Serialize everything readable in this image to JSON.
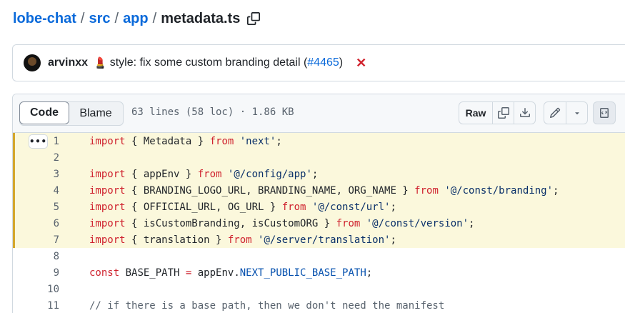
{
  "breadcrumb": {
    "repo": "lobe-chat",
    "dir1": "src",
    "dir2": "app",
    "sep": "/",
    "file": "metadata.ts"
  },
  "commit": {
    "author": "arvinxx",
    "emoji": "💄",
    "message_prefix": "style: fix some custom branding detail (",
    "pr": "#4465",
    "message_suffix": ")",
    "status_icon": "x-icon",
    "status_color": "#d1242f"
  },
  "toolbar": {
    "code_tab": "Code",
    "blame_tab": "Blame",
    "file_info": "63 lines (58 loc) · 1.86 KB",
    "raw_label": "Raw",
    "icons": [
      "copy-icon",
      "download-icon",
      "pencil-icon",
      "chevron-down-icon",
      "symbols-icon"
    ]
  },
  "code": {
    "line_numbers": [
      "1",
      "2",
      "3",
      "4",
      "5",
      "6",
      "7",
      "8",
      "9",
      "10",
      "11"
    ],
    "highlight_lines": "1-7",
    "lines": [
      [
        [
          "kw",
          "import"
        ],
        [
          "t",
          " { Metadata } "
        ],
        [
          "kw",
          "from"
        ],
        [
          "t",
          " "
        ],
        [
          "str",
          "'next'"
        ],
        [
          "t",
          ";"
        ]
      ],
      [],
      [
        [
          "kw",
          "import"
        ],
        [
          "t",
          " { appEnv } "
        ],
        [
          "kw",
          "from"
        ],
        [
          "t",
          " "
        ],
        [
          "str",
          "'@/config/app'"
        ],
        [
          "t",
          ";"
        ]
      ],
      [
        [
          "kw",
          "import"
        ],
        [
          "t",
          " { BRANDING_LOGO_URL, BRANDING_NAME, ORG_NAME } "
        ],
        [
          "kw",
          "from"
        ],
        [
          "t",
          " "
        ],
        [
          "str",
          "'@/const/branding'"
        ],
        [
          "t",
          ";"
        ]
      ],
      [
        [
          "kw",
          "import"
        ],
        [
          "t",
          " { OFFICIAL_URL, OG_URL } "
        ],
        [
          "kw",
          "from"
        ],
        [
          "t",
          " "
        ],
        [
          "str",
          "'@/const/url'"
        ],
        [
          "t",
          ";"
        ]
      ],
      [
        [
          "kw",
          "import"
        ],
        [
          "t",
          " { isCustomBranding, isCustomORG } "
        ],
        [
          "kw",
          "from"
        ],
        [
          "t",
          " "
        ],
        [
          "str",
          "'@/const/version'"
        ],
        [
          "t",
          ";"
        ]
      ],
      [
        [
          "kw",
          "import"
        ],
        [
          "t",
          " { translation } "
        ],
        [
          "kw",
          "from"
        ],
        [
          "t",
          " "
        ],
        [
          "str",
          "'@/server/translation'"
        ],
        [
          "t",
          ";"
        ]
      ],
      [],
      [
        [
          "kw",
          "const"
        ],
        [
          "t",
          " BASE_PATH "
        ],
        [
          "kw",
          "="
        ],
        [
          "t",
          " appEnv."
        ],
        [
          "const",
          "NEXT_PUBLIC_BASE_PATH"
        ],
        [
          "t",
          ";"
        ]
      ],
      [],
      [
        [
          "cm",
          "// if there is a base path, then we don't need the manifest"
        ]
      ]
    ],
    "expand_button": "•••"
  }
}
